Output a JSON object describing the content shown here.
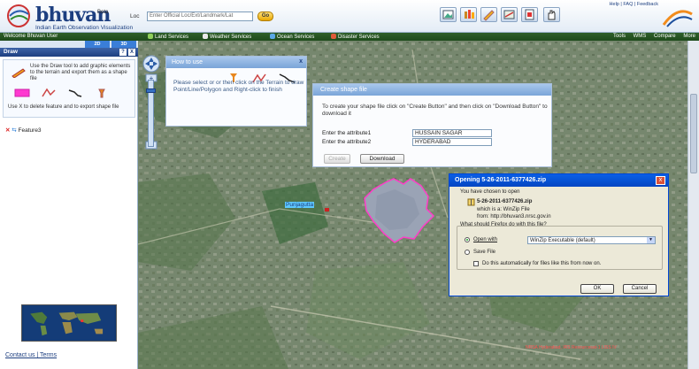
{
  "app": {
    "logo_name": "bhuvan",
    "logo_beta": "Beta",
    "logo_subtitle": "Indian Earth Observation Visualization"
  },
  "search": {
    "label": "Loc",
    "value": "Enter Official Loc/Ext/Landmark/Lat",
    "go_label": "Go"
  },
  "header": {
    "top_links": "Help | FAQ | Feedback"
  },
  "navbar": {
    "welcome": "Welcome Bhuvan User",
    "items": [
      "Land Services",
      "Weather Services",
      "Ocean Services",
      "Disaster Services"
    ],
    "right_items": [
      "Tools",
      "WMS",
      "Compare",
      "More"
    ]
  },
  "left_panel": {
    "mode_tabs": [
      "2D",
      "3D"
    ],
    "panel_title": "Draw",
    "help_btn": "?",
    "close_btn": "X",
    "draw_instructions": "Use the Draw tool to add graphic elements to the terrain and export them as a shape file",
    "delete_instructions": "Use  X  to delete feature and  to export shape file",
    "feature_name": "Feature3",
    "footer_links": "Contact us | Terms"
  },
  "howto_popup": {
    "title": "How to use",
    "close": "x",
    "text": "Please select  or  or  then click on the Terrain to draw Point/Line/Polygon and Right-click to finish"
  },
  "shape_dialog": {
    "title": "Create shape file",
    "instructions": "To create your shape file click on \"Create Button\" and then click on \"Download Button\" to download it",
    "attr1_label": "Enter the attribute1",
    "attr1_value": "HUSSAIN SAGAR",
    "attr2_label": "Enter the attribute2",
    "attr2_value": "HYDERABAD",
    "create_label": "Create",
    "download_label": "Download"
  },
  "download_dialog": {
    "title": "Opening 5-26-2011-6377426.zip",
    "close": "x",
    "chosen_label": "You have chosen to open",
    "filename": "5-26-2011-6377426.zip",
    "which_is": "which is a:  WinZip File",
    "from": "from: http://bhuvan3.nrsc.gov.in",
    "question": "What should Firefox do with this file?",
    "open_with_label": "Open with",
    "open_with_value": "WinZip Executable (default)",
    "save_label": "Save File",
    "auto_label": "Do this automatically for files like this from now on.",
    "ok_label": "OK",
    "cancel_label": "Cancel"
  },
  "map": {
    "place_label": "Punjagutta",
    "credit": "NRSA Hyderabad, IRS Resourcesat-1 LISS IV"
  }
}
